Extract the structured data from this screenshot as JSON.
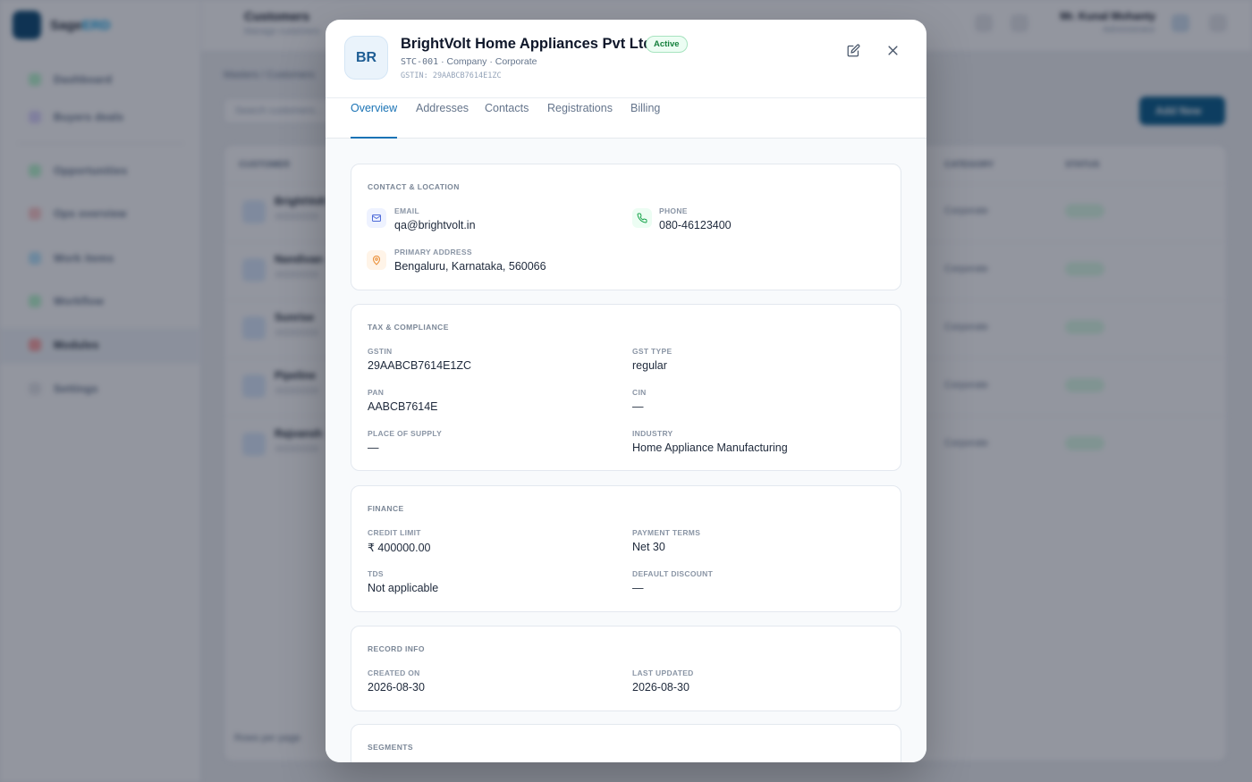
{
  "background": {
    "brand": {
      "prefix": "Sage",
      "accent": "ERD"
    },
    "nav": [
      "Dashboard",
      "Buyers deals",
      "Opportunities",
      "Ops overview",
      "Work items",
      "Workflow",
      "Modules",
      "Settings"
    ],
    "header": {
      "title": "Customers",
      "subtitle": "Manage customers",
      "user_name": "Mr. Kunal Mohanty",
      "user_sub": "Administrator"
    },
    "breadcrumb": "Masters  /  Customers",
    "search_placeholder": "Search customers...",
    "add_button": "Add New",
    "table_headers": [
      "CUSTOMER",
      "CATEGORY",
      "STATUS"
    ],
    "rows": [
      {
        "name": "BrightVolt",
        "category": "Corporate",
        "status": "Active"
      },
      {
        "name": "Nandivan",
        "category": "Corporate",
        "status": "Active"
      },
      {
        "name": "Sunrise",
        "category": "Corporate",
        "status": "Active"
      },
      {
        "name": "Pipeline",
        "category": "Corporate",
        "status": "Active"
      },
      {
        "name": "Rajvansh",
        "category": "Corporate",
        "status": "Active"
      }
    ],
    "footer": "Rows per page"
  },
  "modal": {
    "avatar": "BR",
    "title": "BrightVolt Home Appliances Pvt Ltd",
    "status": "Active",
    "code": "STC-001",
    "meta_rest": " · Company · Corporate",
    "gstin_line": "GSTIN: 29AABCB7614E1ZC",
    "tabs": [
      "Overview",
      "Addresses",
      "Contacts",
      "Registrations",
      "Billing"
    ],
    "contact": {
      "title": "CONTACT & LOCATION",
      "email_label": "EMAIL",
      "email": "qa@brightvolt.in",
      "phone_label": "PHONE",
      "phone": "080-46123400",
      "address_label": "PRIMARY ADDRESS",
      "address": "Bengaluru, Karnataka, 560066"
    },
    "tax": {
      "title": "TAX & COMPLIANCE",
      "gstin_label": "GSTIN",
      "gstin": "29AABCB7614E1ZC",
      "gst_type_label": "GST TYPE",
      "gst_type": "regular",
      "pan_label": "PAN",
      "pan": "AABCB7614E",
      "cin_label": "CIN",
      "cin": "—",
      "pos_label": "PLACE OF SUPPLY",
      "pos": "—",
      "industry_label": "INDUSTRY",
      "industry": "Home Appliance Manufacturing"
    },
    "finance": {
      "title": "FINANCE",
      "credit_label": "CREDIT LIMIT",
      "credit": "₹ 400000.00",
      "terms_label": "PAYMENT TERMS",
      "terms": "Net 30",
      "tds_label": "TDS",
      "tds": "Not applicable",
      "discount_label": "DEFAULT DISCOUNT",
      "discount": "—"
    },
    "record": {
      "title": "RECORD INFO",
      "created_label": "CREATED ON",
      "created": "2026-08-30",
      "updated_label": "LAST UPDATED",
      "updated": "2026-08-30"
    },
    "segments": {
      "title": "SEGMENTS"
    }
  }
}
